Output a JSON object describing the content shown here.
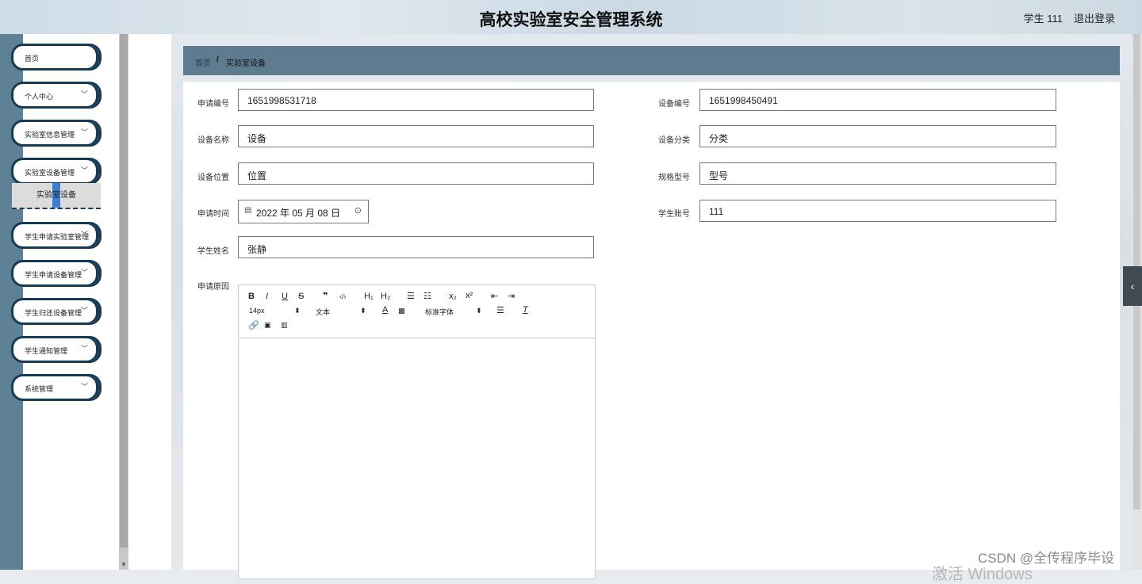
{
  "header": {
    "title": "高校实验室安全管理系统",
    "user": "学生 111",
    "logout": "退出登录"
  },
  "sidebar": {
    "items": [
      {
        "label": "首页",
        "chevron": ""
      },
      {
        "label": "个人中心",
        "chevron": "﹀"
      },
      {
        "label": "实验室信息管理",
        "chevron": "﹀"
      },
      {
        "label": "实验室设备管理",
        "chevron": "﹀"
      },
      {
        "label": "学生申请实验室管理",
        "chevron": "﹀"
      },
      {
        "label": "学生申请设备管理",
        "chevron": "﹀"
      },
      {
        "label": "学生归还设备管理",
        "chevron": "﹀"
      },
      {
        "label": "学生通知管理",
        "chevron": "﹀"
      },
      {
        "label": "系统管理",
        "chevron": "﹀"
      }
    ],
    "active_sub": "实验室设备"
  },
  "breadcrumb": {
    "home": "首页",
    "separator": "/",
    "current": "实验室设备"
  },
  "form": {
    "apply_no": {
      "label": "申请编号",
      "value": "1651998531718"
    },
    "device_no": {
      "label": "设备编号",
      "value": "1651998450491"
    },
    "device_name": {
      "label": "设备名称",
      "value": "设备"
    },
    "device_category": {
      "label": "设备分类",
      "value": "分类"
    },
    "device_location": {
      "label": "设备位置",
      "value": "位置"
    },
    "spec_model": {
      "label": "规格型号",
      "value": "型号"
    },
    "apply_time": {
      "label": "申请时间",
      "value": "2022 年 05 月 08 日"
    },
    "student_account": {
      "label": "学生账号",
      "value": "111"
    },
    "student_name": {
      "label": "学生姓名",
      "value": "张静"
    },
    "apply_reason": {
      "label": "申请原因"
    }
  },
  "editor": {
    "row1": [
      "B",
      "I",
      "U",
      "S",
      "❞",
      "‹/›",
      "H₁",
      "H₂",
      "☰",
      "☷",
      "x₂",
      "x²",
      "⇤",
      "⇥"
    ],
    "font_size": "14px",
    "text_style": "文本",
    "font_family": "标准字体",
    "align_icon": "align-icon",
    "clear_icon": "clear-format-icon"
  },
  "watermark": "CSDN @全传程序毕设",
  "watermark2": "激活 Windows"
}
